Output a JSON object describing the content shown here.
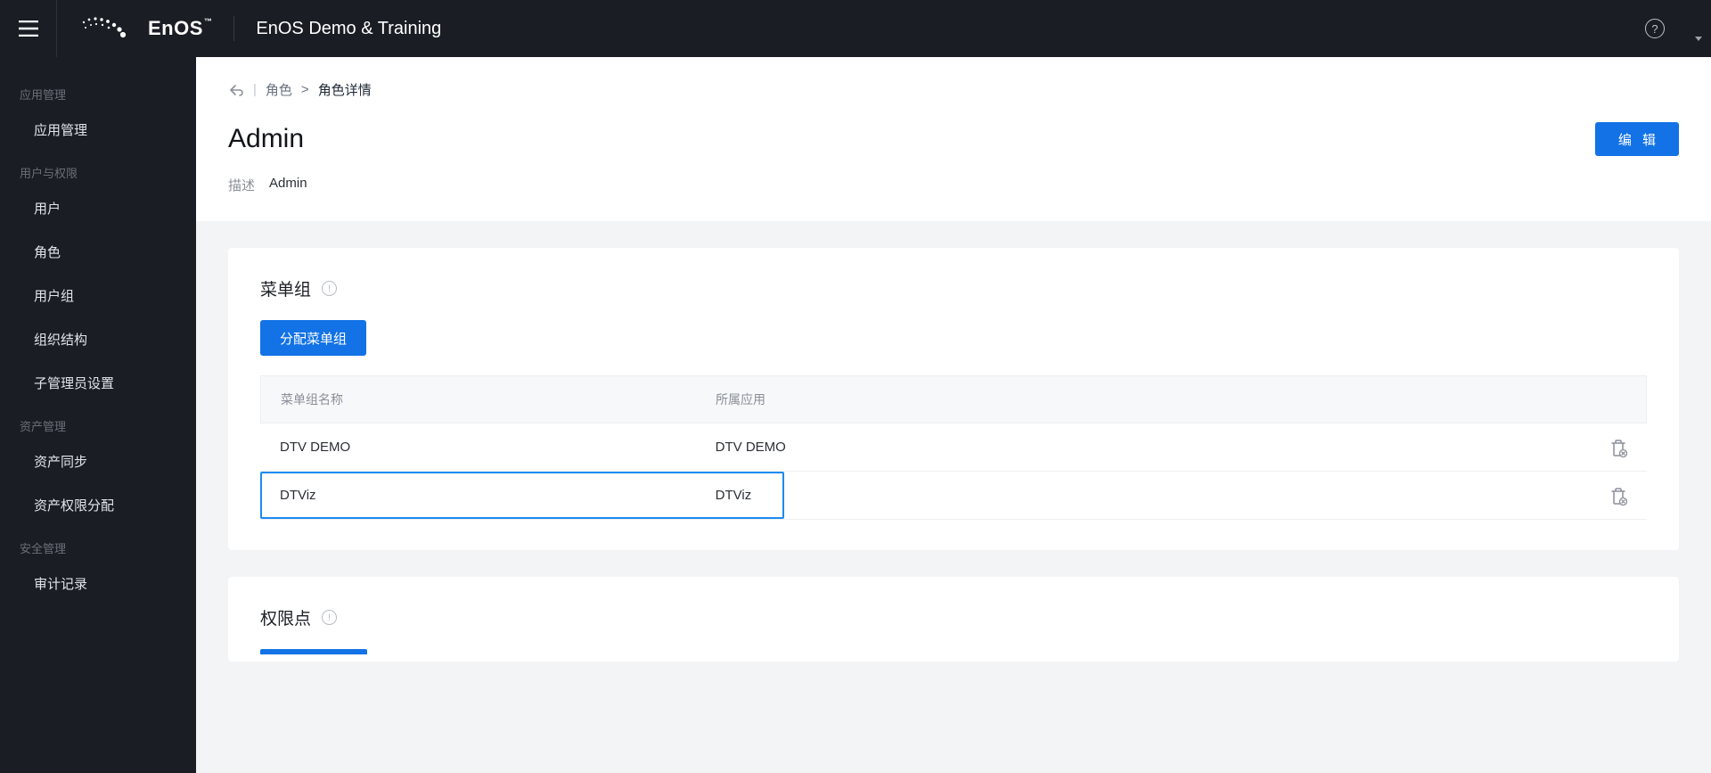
{
  "header": {
    "brand": "EnOS",
    "tm": "™",
    "org": "EnOS Demo & Training"
  },
  "sidebar": {
    "groups": [
      {
        "title": "应用管理",
        "items": [
          {
            "label": "应用管理"
          }
        ]
      },
      {
        "title": "用户与权限",
        "items": [
          {
            "label": "用户"
          },
          {
            "label": "角色"
          },
          {
            "label": "用户组"
          },
          {
            "label": "组织结构"
          },
          {
            "label": "子管理员设置"
          }
        ]
      },
      {
        "title": "资产管理",
        "items": [
          {
            "label": "资产同步"
          },
          {
            "label": "资产权限分配"
          }
        ]
      },
      {
        "title": "安全管理",
        "items": [
          {
            "label": "审计记录"
          }
        ]
      }
    ]
  },
  "breadcrumb": {
    "parent": "角色",
    "sep": ">",
    "current": "角色详情"
  },
  "page": {
    "title": "Admin",
    "edit_label": "编 辑",
    "desc_label": "描述",
    "desc_value": "Admin"
  },
  "menu_section": {
    "title": "菜单组",
    "assign_label": "分配菜单组",
    "columns": {
      "name": "菜单组名称",
      "app": "所属应用"
    },
    "rows": [
      {
        "name": "DTV DEMO",
        "app": "DTV DEMO",
        "highlight": false
      },
      {
        "name": "DTViz",
        "app": "DTViz",
        "highlight": true
      }
    ]
  },
  "perm_section": {
    "title": "权限点"
  }
}
